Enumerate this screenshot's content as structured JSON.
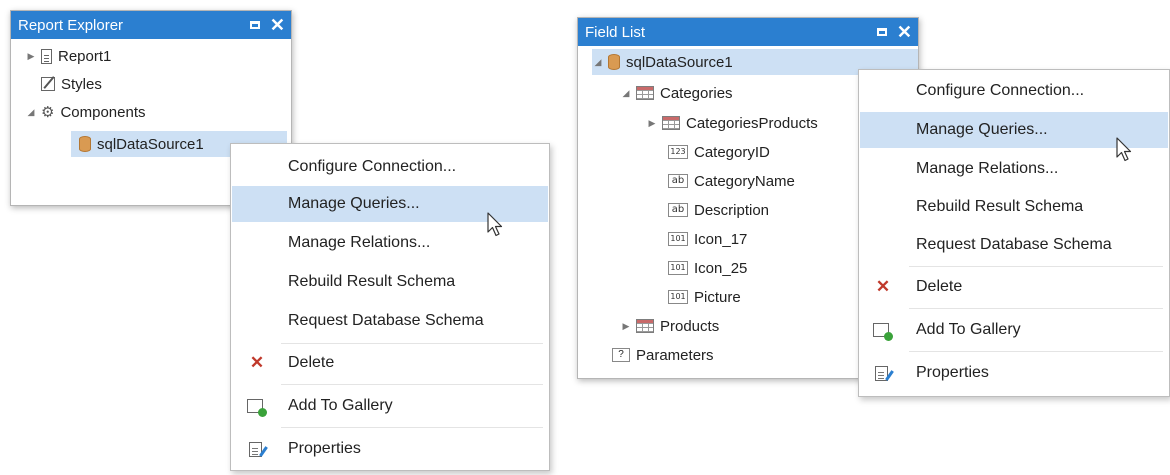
{
  "report_explorer": {
    "title": "Report Explorer",
    "items": [
      {
        "label": "Report1",
        "icon": "report-document-icon"
      },
      {
        "label": "Styles",
        "icon": "styles-icon"
      },
      {
        "label": "Components",
        "icon": "gear-icon"
      },
      {
        "label": "sqlDataSource1",
        "icon": "database-icon"
      }
    ]
  },
  "context_menu_left": {
    "items": [
      "Configure Connection...",
      "Manage Queries...",
      "Manage Relations...",
      "Rebuild Result Schema",
      "Request Database Schema",
      "Delete",
      "Add To Gallery",
      "Properties"
    ],
    "highlighted": "Manage Queries..."
  },
  "field_list": {
    "title": "Field List",
    "items": [
      {
        "label": "sqlDataSource1",
        "icon": "database-icon"
      },
      {
        "label": "Categories",
        "icon": "table-icon"
      },
      {
        "label": "CategoriesProducts",
        "icon": "table-icon"
      },
      {
        "label": "CategoryID",
        "icon": "number-field-icon",
        "type": "123"
      },
      {
        "label": "CategoryName",
        "icon": "string-field-icon",
        "type": "ab"
      },
      {
        "label": "Description",
        "icon": "string-field-icon",
        "type": "ab"
      },
      {
        "label": "Icon_17",
        "icon": "binary-field-icon",
        "type": "101"
      },
      {
        "label": "Icon_25",
        "icon": "binary-field-icon",
        "type": "101"
      },
      {
        "label": "Picture",
        "icon": "binary-field-icon",
        "type": "101"
      },
      {
        "label": "Products",
        "icon": "table-icon"
      },
      {
        "label": "Parameters",
        "icon": "parameters-icon",
        "type": "?"
      }
    ]
  },
  "context_menu_right": {
    "items": [
      "Configure Connection...",
      "Manage Queries...",
      "Manage Relations...",
      "Rebuild Result Schema",
      "Request Database Schema",
      "Delete",
      "Add To Gallery",
      "Properties"
    ],
    "highlighted": "Manage Queries..."
  },
  "colors": {
    "title_bar": "#2b7fd0",
    "selection": "#cde0f4",
    "delete_icon": "#c0392b"
  }
}
